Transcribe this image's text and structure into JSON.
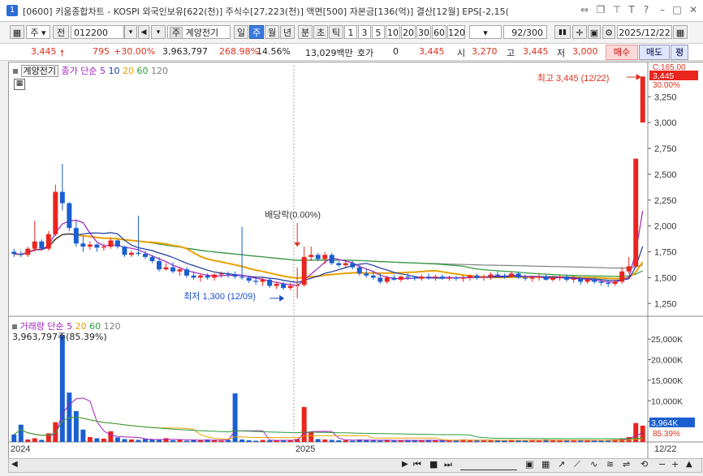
{
  "window": {
    "number": "1",
    "title": "[0600] 키움종합차트 - KOSPI 외국인보유[622(천)] 주식수[27,223(천)] 액면[500] 자본금[136(억)] 결산[12월] EPS[-2,15("
  },
  "toolbar": {
    "period_select": "주",
    "prev_label": "전",
    "code": "012200",
    "stock_name_badge": "주",
    "stock_name": "계양전기",
    "periods": [
      "일",
      "주",
      "월",
      "년",
      "분",
      "초",
      "틱"
    ],
    "selected_period": "주",
    "minute_options": [
      "1",
      "3",
      "5",
      "10",
      "20",
      "30",
      "60",
      "120"
    ],
    "count": "92/300",
    "date": "2025/12/22"
  },
  "quote": {
    "price": "3,445",
    "change": "795",
    "change_pct": "+30.00%",
    "volume": "3,963,797",
    "volume_ratio": "268.98%",
    "turnover": "14.56%",
    "amount": "13,029백만",
    "ask_label": "호가",
    "ask_value": "0",
    "current": "3,445",
    "open_label": "시",
    "open": "3,270",
    "high_label": "고",
    "high": "3,445",
    "low_label": "저",
    "low": "3,000",
    "buy_label": "매수",
    "sell_label": "매도",
    "eval_label": "평"
  },
  "price_panel": {
    "stock_label": "계양전기",
    "ma_prefix": "종가 단순",
    "ma_periods": [
      "5",
      "10",
      "20",
      "60",
      "120"
    ],
    "ma_colors": [
      "#a020c0",
      "#1a3a9a",
      "#e8a000",
      "#2e9a3e",
      "#808080"
    ],
    "annotation_dividend": "배당락(0.00%)",
    "annotation_high": "최고 3,445 (12/22)",
    "annotation_low": "최저 1,300 (12/09)",
    "axis_top_label": "C:165.00",
    "axis_price_box": "3,445",
    "axis_pct_box": "30.00%",
    "y_ticks": [
      3250,
      3000,
      2750,
      2500,
      2250,
      2000,
      1750,
      1500,
      1250
    ],
    "y_tick_labels": [
      "3,250",
      "3,000",
      "2,750",
      "2,500",
      "2,250",
      "2,000",
      "1,750",
      "1,500",
      "1,250"
    ]
  },
  "volume_panel": {
    "title": "거래량",
    "ma_prefix": "단순",
    "ma_periods": [
      "5",
      "20",
      "60",
      "120"
    ],
    "ma_colors": [
      "#a020c0",
      "#e8a000",
      "#2e9a3e",
      "#808080"
    ],
    "current_text": "3,963,797주(85.39%)",
    "y_tick_labels": [
      "25,000K",
      "20,000K",
      "15,000K",
      "10,000K",
      "5,000K"
    ],
    "axis_box": "3,964K",
    "axis_pct": "85.39%"
  },
  "xaxis": {
    "labels": [
      "2024",
      "2025"
    ],
    "right_label": "12/22"
  },
  "colors": {
    "up": "#e8261e",
    "down": "#1a5fd0",
    "accent": "#3a7be0"
  },
  "chart_data": {
    "type": "candlestick",
    "x_labels": [
      "2024",
      "2025",
      "12/22"
    ],
    "ylim": [
      1150,
      3550
    ],
    "candles": [
      [
        1750,
        1780,
        1700,
        1730
      ],
      [
        1730,
        1760,
        1700,
        1720
      ],
      [
        1720,
        1800,
        1700,
        1780
      ],
      [
        1780,
        2050,
        1750,
        1850
      ],
      [
        1850,
        1870,
        1760,
        1780
      ],
      [
        1780,
        1950,
        1760,
        1920
      ],
      [
        1920,
        2400,
        1900,
        2330
      ],
      [
        2330,
        2600,
        2150,
        2220
      ],
      [
        2220,
        2230,
        1950,
        1980
      ],
      [
        1980,
        2050,
        1800,
        1830
      ],
      [
        1830,
        1900,
        1750,
        1800
      ],
      [
        1800,
        1850,
        1770,
        1820
      ],
      [
        1820,
        1830,
        1750,
        1790
      ],
      [
        1790,
        1830,
        1760,
        1800
      ],
      [
        1800,
        1880,
        1780,
        1860
      ],
      [
        1860,
        1870,
        1780,
        1800
      ],
      [
        1800,
        1810,
        1700,
        1720
      ],
      [
        1720,
        1760,
        1700,
        1740
      ],
      [
        1740,
        2100,
        1710,
        1730
      ],
      [
        1730,
        1760,
        1680,
        1700
      ],
      [
        1700,
        1720,
        1640,
        1660
      ],
      [
        1660,
        1700,
        1560,
        1580
      ],
      [
        1580,
        1640,
        1570,
        1600
      ],
      [
        1600,
        1650,
        1540,
        1560
      ],
      [
        1560,
        1600,
        1520,
        1580
      ],
      [
        1580,
        1600,
        1500,
        1520
      ],
      [
        1520,
        1560,
        1480,
        1500
      ],
      [
        1500,
        1540,
        1460,
        1520
      ],
      [
        1520,
        1540,
        1480,
        1500
      ],
      [
        1500,
        1540,
        1470,
        1530
      ],
      [
        1530,
        1560,
        1500,
        1540
      ],
      [
        1540,
        1560,
        1500,
        1530
      ],
      [
        1530,
        1560,
        1490,
        1510
      ],
      [
        1510,
        1990,
        1480,
        1500
      ],
      [
        1500,
        1520,
        1450,
        1470
      ],
      [
        1470,
        1500,
        1430,
        1460
      ],
      [
        1460,
        1500,
        1420,
        1480
      ],
      [
        1480,
        1500,
        1400,
        1420
      ],
      [
        1420,
        1460,
        1390,
        1440
      ],
      [
        1440,
        1460,
        1380,
        1400
      ],
      [
        1400,
        1450,
        1380,
        1420
      ],
      [
        1420,
        1600,
        1300,
        1430
      ],
      [
        1430,
        1800,
        1410,
        1700
      ],
      [
        1700,
        1800,
        1660,
        1720
      ],
      [
        1720,
        1740,
        1660,
        1680
      ],
      [
        1680,
        1750,
        1630,
        1720
      ],
      [
        1720,
        1740,
        1620,
        1640
      ],
      [
        1640,
        1660,
        1600,
        1620
      ],
      [
        1620,
        1660,
        1590,
        1640
      ],
      [
        1640,
        1660,
        1580,
        1600
      ],
      [
        1600,
        1620,
        1520,
        1540
      ],
      [
        1540,
        1580,
        1500,
        1520
      ],
      [
        1520,
        1560,
        1480,
        1500
      ],
      [
        1500,
        1540,
        1440,
        1460
      ],
      [
        1460,
        1520,
        1440,
        1500
      ],
      [
        1500,
        1530,
        1470,
        1480
      ],
      [
        1480,
        1520,
        1460,
        1510
      ],
      [
        1510,
        1540,
        1480,
        1500
      ],
      [
        1500,
        1520,
        1470,
        1490
      ],
      [
        1490,
        1530,
        1470,
        1510
      ],
      [
        1510,
        1540,
        1480,
        1500
      ],
      [
        1500,
        1530,
        1470,
        1510
      ],
      [
        1510,
        1530,
        1480,
        1490
      ],
      [
        1490,
        1520,
        1470,
        1500
      ],
      [
        1500,
        1520,
        1470,
        1490
      ],
      [
        1490,
        1520,
        1460,
        1500
      ],
      [
        1500,
        1530,
        1470,
        1520
      ],
      [
        1520,
        1540,
        1480,
        1500
      ],
      [
        1500,
        1530,
        1470,
        1510
      ],
      [
        1510,
        1550,
        1480,
        1530
      ],
      [
        1530,
        1560,
        1500,
        1520
      ],
      [
        1520,
        1540,
        1490,
        1510
      ],
      [
        1510,
        1560,
        1500,
        1540
      ],
      [
        1540,
        1560,
        1490,
        1500
      ],
      [
        1500,
        1530,
        1470,
        1490
      ],
      [
        1490,
        1520,
        1460,
        1500
      ],
      [
        1500,
        1540,
        1470,
        1510
      ],
      [
        1510,
        1530,
        1470,
        1480
      ],
      [
        1480,
        1520,
        1460,
        1500
      ],
      [
        1500,
        1530,
        1470,
        1510
      ],
      [
        1510,
        1530,
        1460,
        1480
      ],
      [
        1480,
        1520,
        1450,
        1490
      ],
      [
        1490,
        1510,
        1430,
        1460
      ],
      [
        1460,
        1500,
        1440,
        1480
      ],
      [
        1480,
        1500,
        1440,
        1460
      ],
      [
        1460,
        1480,
        1420,
        1450
      ],
      [
        1450,
        1470,
        1410,
        1440
      ],
      [
        1440,
        1480,
        1420,
        1460
      ],
      [
        1460,
        1600,
        1440,
        1560
      ],
      [
        1560,
        1700,
        1540,
        1610
      ],
      [
        1610,
        2650,
        1600,
        2650
      ],
      [
        3000,
        3445,
        3000,
        3445
      ]
    ],
    "volume_k": [
      1800,
      4200,
      600,
      900,
      500,
      2100,
      4800,
      26000,
      12000,
      7500,
      3000,
      1200,
      900,
      800,
      2600,
      1100,
      700,
      600,
      500,
      700,
      600,
      500,
      900,
      400,
      500,
      300,
      400,
      500,
      600,
      400,
      300,
      500,
      11800,
      600,
      400,
      300,
      500,
      400,
      300,
      500,
      400,
      700,
      8500,
      2400,
      700,
      600,
      500,
      400,
      400,
      300,
      600,
      500,
      400,
      300,
      500,
      300,
      400,
      500,
      300,
      400,
      500,
      300,
      400,
      300,
      500,
      600,
      400,
      300,
      500,
      400,
      300,
      400,
      500,
      300,
      400,
      500,
      300,
      600,
      400,
      300,
      400,
      300,
      500,
      400,
      300,
      400,
      500,
      600,
      800,
      1200,
      4600,
      3964
    ]
  }
}
